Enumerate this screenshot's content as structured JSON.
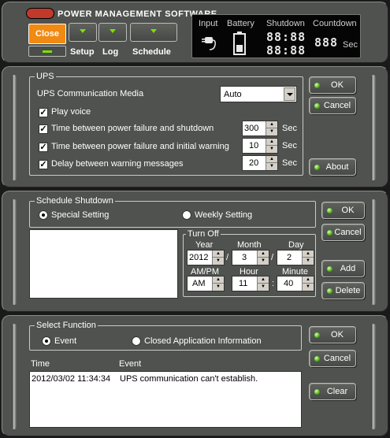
{
  "header": {
    "title": "POWER MANAGEMENT SOFTWARE",
    "close_label": "Close",
    "tabs": [
      "Setup",
      "Log",
      "Schedule"
    ],
    "lcd": {
      "input_caption": "Input",
      "battery_caption": "Battery",
      "shutdown_caption": "Shutdown",
      "countdown_caption": "Countdown",
      "shutdown_digits_top": "88:88",
      "shutdown_digits_bottom": "88:88",
      "countdown_digits": "888",
      "countdown_unit": "Sec"
    }
  },
  "ups_panel": {
    "group_title": "UPS",
    "comm_label": "UPS Communication Media",
    "comm_value": "Auto",
    "play_voice": "Play voice",
    "row1_label": "Time between power failure and shutdown",
    "row1_value": "300",
    "row2_label": "Time between power failure and initial warning",
    "row2_value": "10",
    "row3_label": "Delay between warning messages",
    "row3_value": "20",
    "unit": "Sec",
    "ok": "OK",
    "cancel": "Cancel",
    "about": "About"
  },
  "schedule_panel": {
    "group_title": "Schedule Shutdown",
    "special": "Special Setting",
    "weekly": "Weekly Setting",
    "turnoff_title": "Turn Off",
    "year_label": "Year",
    "year_value": "2012",
    "month_label": "Month",
    "month_value": "3",
    "day_label": "Day",
    "day_value": "2",
    "ampm_label": "AM/PM",
    "ampm_value": "AM",
    "hour_label": "Hour",
    "hour_value": "11",
    "minute_label": "Minute",
    "minute_value": "40",
    "date_sep": "/",
    "time_sep": ":",
    "ok": "OK",
    "cancel": "Cancel",
    "add": "Add",
    "delete": "Delete"
  },
  "function_panel": {
    "group_title": "Select Function",
    "event": "Event",
    "closed_app": "Closed Application Information",
    "col_time": "Time",
    "col_event": "Event",
    "rows": [
      {
        "time": "2012/03/02 11:34:34",
        "event": "UPS communication can't establish."
      }
    ],
    "ok": "OK",
    "cancel": "Cancel",
    "clear": "Clear"
  }
}
